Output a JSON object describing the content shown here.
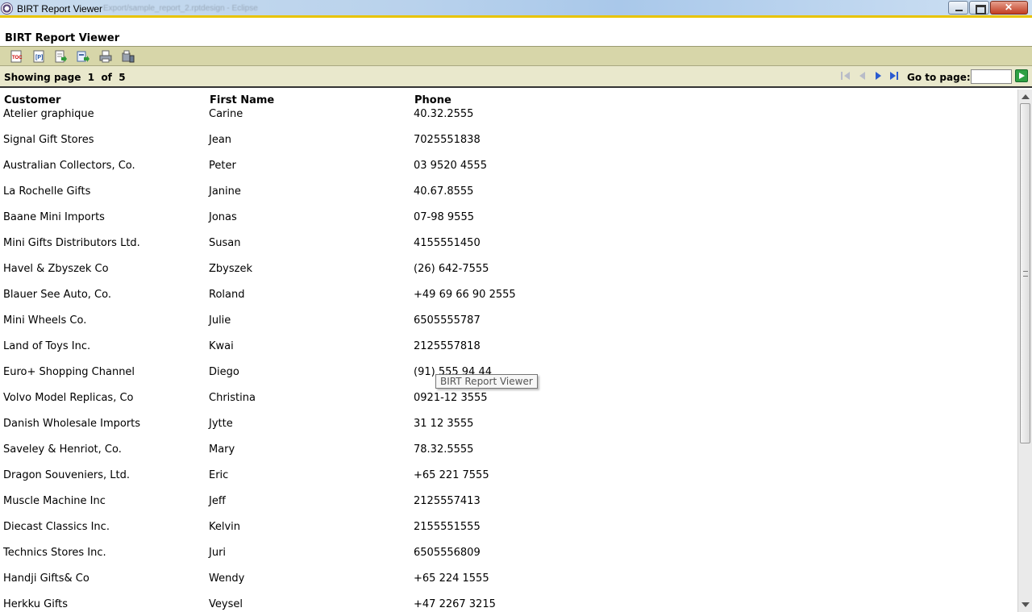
{
  "window": {
    "title": "BIRT Report Viewer",
    "blurred_path": "Export/sample_report_2.rptdesign - Eclipse"
  },
  "viewer": {
    "title": "BIRT Report Viewer",
    "toolbar": [
      {
        "name": "toc-icon"
      },
      {
        "name": "parameters-icon"
      },
      {
        "name": "export-data-icon"
      },
      {
        "name": "export-report-icon"
      },
      {
        "name": "print-icon"
      },
      {
        "name": "print-server-icon"
      }
    ]
  },
  "nav": {
    "showing_label": "Showing page",
    "current_page": "1",
    "of_label": "of",
    "total_pages": "5",
    "goto_label": "Go to page:",
    "goto_value": ""
  },
  "table": {
    "headers": [
      "Customer",
      "First Name",
      "Phone"
    ],
    "rows": [
      [
        "Atelier graphique",
        "Carine",
        "40.32.2555"
      ],
      [
        "Signal Gift Stores",
        "Jean",
        "7025551838"
      ],
      [
        "Australian Collectors, Co.",
        "Peter",
        "03 9520 4555"
      ],
      [
        "La Rochelle Gifts",
        "Janine",
        "40.67.8555"
      ],
      [
        "Baane Mini Imports",
        "Jonas",
        "07-98 9555"
      ],
      [
        "Mini Gifts Distributors Ltd.",
        "Susan",
        "4155551450"
      ],
      [
        "Havel & Zbyszek Co",
        "Zbyszek",
        "(26) 642-7555"
      ],
      [
        "Blauer See Auto, Co.",
        "Roland",
        "+49 69 66 90 2555"
      ],
      [
        "Mini Wheels Co.",
        "Julie",
        "6505555787"
      ],
      [
        "Land of Toys Inc.",
        "Kwai",
        "2125557818"
      ],
      [
        "Euro+ Shopping Channel",
        "Diego",
        "(91) 555 94 44"
      ],
      [
        "Volvo Model Replicas, Co",
        "Christina",
        "0921-12 3555"
      ],
      [
        "Danish Wholesale Imports",
        "Jytte",
        "31 12 3555"
      ],
      [
        "Saveley & Henriot, Co.",
        "Mary",
        "78.32.5555"
      ],
      [
        "Dragon Souveniers, Ltd.",
        "Eric",
        "+65 221 7555"
      ],
      [
        "Muscle Machine Inc",
        "Jeff",
        "2125557413"
      ],
      [
        "Diecast Classics Inc.",
        "Kelvin",
        "2155551555"
      ],
      [
        "Technics Stores Inc.",
        "Juri",
        "6505556809"
      ],
      [
        "Handji Gifts& Co",
        "Wendy",
        "+65 224 1555"
      ],
      [
        "Herkku Gifts",
        "Veysel",
        "+47 2267 3215"
      ]
    ]
  },
  "tooltip": "BIRT Report Viewer"
}
